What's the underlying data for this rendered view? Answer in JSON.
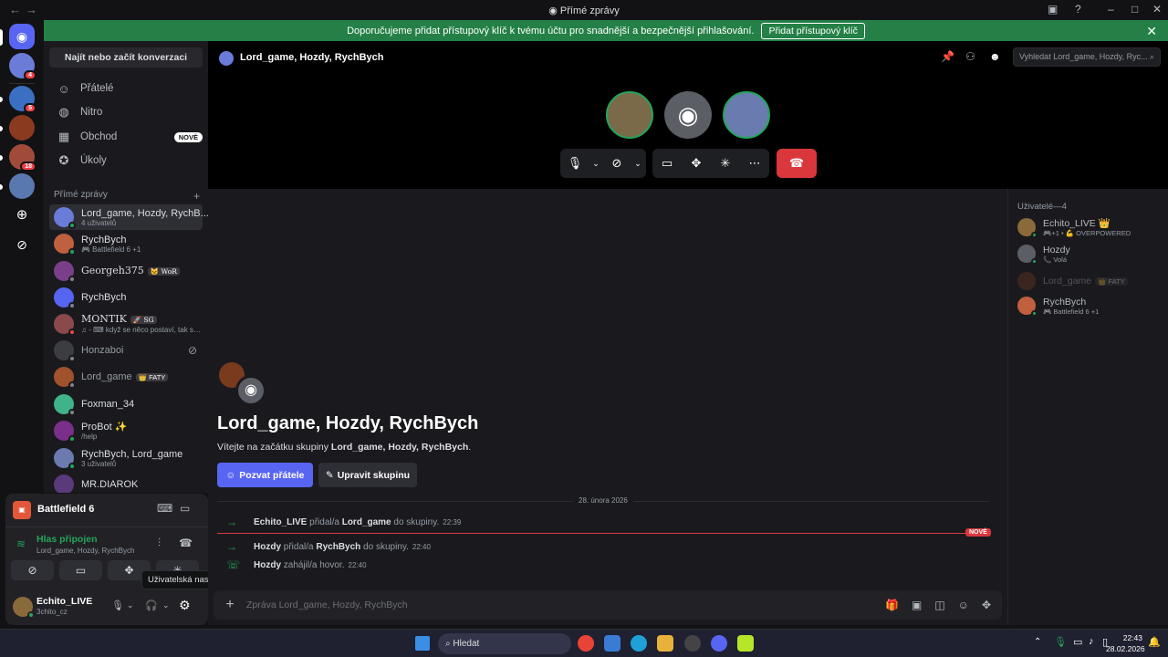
{
  "window": {
    "title": "Přímé zprávy"
  },
  "notice": {
    "text": "Doporučujeme přidat přístupový klíč k tvému účtu pro snadnější a bezpečnější přihlašování.",
    "button": "Přidat přístupový klíč"
  },
  "rail": {
    "badges": {
      "s1": "4",
      "s2": "5",
      "s4": "18"
    }
  },
  "dmlist": {
    "search": "Najít nebo začít konverzaci",
    "nav": [
      {
        "label": "Přátelé",
        "icon": "friends-icon"
      },
      {
        "label": "Nitro",
        "icon": "nitro-icon"
      },
      {
        "label": "Obchod",
        "icon": "shop-icon",
        "badge": "NOVÉ"
      },
      {
        "label": "Úkoly",
        "icon": "quests-icon"
      }
    ],
    "header": "Přímé zprávy",
    "items": [
      {
        "name": "Lord_game, Hozdy, RychB...",
        "sub": "4 uživatelů"
      },
      {
        "name": "RychBych",
        "sub": "🎮 Battlefield 6 +1"
      },
      {
        "name": "Georgeh375",
        "tag": "🐱 WoR"
      },
      {
        "name": "RychBych"
      },
      {
        "name": "MONTÍK",
        "tag": "🚀 SG",
        "sub": "♫ - ⌨ když se něco postaví, tak se n"
      },
      {
        "name": "Honzaboi"
      },
      {
        "name": "Lord_game",
        "tag": "👑 FATY"
      },
      {
        "name": "Foxman_34"
      },
      {
        "name": "ProBot ✨",
        "sub": "/help"
      },
      {
        "name": "RychBych, Lord_game",
        "sub": "3 uživatelů"
      },
      {
        "name": "MR.DIAROK"
      }
    ]
  },
  "panel": {
    "game": "Battlefield 6",
    "voice_status": "Hlas připojen",
    "voice_channel": "Lord_game, Hozdy, RychBych",
    "username": "Echito_LIVE",
    "handle": "3chito_cz",
    "tooltip": "Uživatelská nastavení"
  },
  "call": {
    "title": "Lord_game, Hozdy, RychBych",
    "search_placeholder": "Vyhledat Lord_game, Hozdy, Ryc..."
  },
  "chat": {
    "welcome_title": "Lord_game, Hozdy, RychBych",
    "welcome_prefix": "Vítejte na začátku skupiny ",
    "welcome_group": "Lord_game, Hozdy, RychBych",
    "welcome_suffix": ".",
    "invite_button": "Pozvat přátele",
    "edit_button": "Upravit skupinu",
    "date": "28. února 2026",
    "new_label": "NOVÉ",
    "messages": [
      {
        "actor": "Echito_LIVE",
        "verb": " přidal/a ",
        "target": "Lord_game",
        "rest": " do skupiny.",
        "time": "22:39"
      },
      {
        "actor": "Hozdy",
        "verb": " přidal/a ",
        "target": "RychBych",
        "rest": " do skupiny.",
        "time": "22:40"
      },
      {
        "actor": "Hozdy",
        "verb": " zahájil/a hovor.",
        "target": "",
        "rest": "",
        "time": "22:40"
      }
    ],
    "composer_placeholder": "Zpráva Lord_game, Hozdy, RychBych"
  },
  "members": {
    "header": "Uživatelé—4",
    "list": [
      {
        "name": "Echito_LIVE 👑",
        "sub": "🎮+1 • 💪 OVERPOWERED"
      },
      {
        "name": "Hozdy",
        "sub": "📞 Volá"
      },
      {
        "name": "Lord_game",
        "tag": "👑 FATY"
      },
      {
        "name": "RychBych",
        "sub": "🎮 Battlefield 6 +1"
      }
    ]
  },
  "taskbar": {
    "search": "Hledat",
    "time": "22:43",
    "date": "28.02.2026"
  },
  "colors": {
    "accent": "#5865f2",
    "green": "#23a55a",
    "danger": "#da373c",
    "notice": "#248046"
  }
}
